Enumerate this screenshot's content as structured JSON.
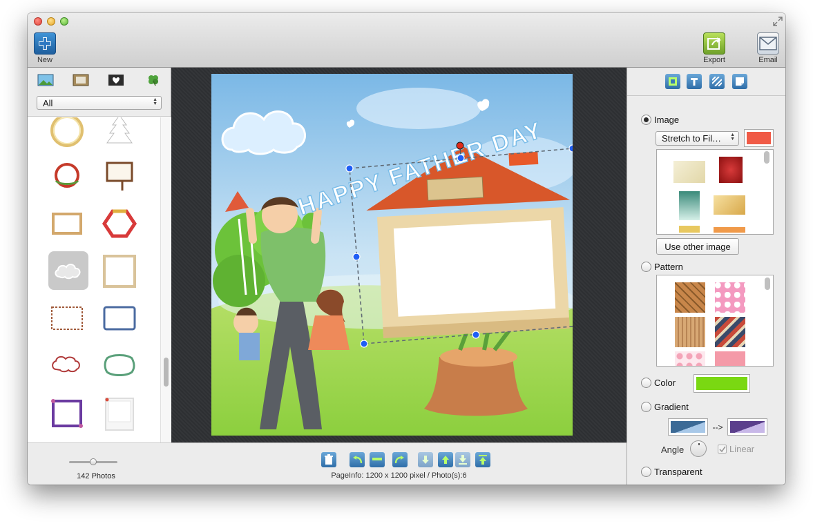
{
  "toolbar": {
    "new_label": "New",
    "export_label": "Export",
    "email_label": "Email"
  },
  "left_panel": {
    "category_select": "All",
    "photo_count_label": "142 Photos",
    "zoom_slider": 0.5
  },
  "canvas": {
    "title_text": "HAPPY FATHER DAY",
    "page_info": "PageInfo: 1200 x 1200 pixel / Photo(s):6"
  },
  "right_panel": {
    "image_label": "Image",
    "fill_mode_select": "Stretch to Fil…",
    "fill_color": "#f05a46",
    "use_other_image_label": "Use other image",
    "pattern_label": "Pattern",
    "color_label": "Color",
    "color_value": "#7ad812",
    "gradient_label": "Gradient",
    "gradient_arrow": "-->",
    "gradient_start": "#3c6a96",
    "gradient_end": "#5b3f8c",
    "angle_label": "Angle",
    "linear_label": "Linear",
    "transparent_label": "Transparent"
  }
}
